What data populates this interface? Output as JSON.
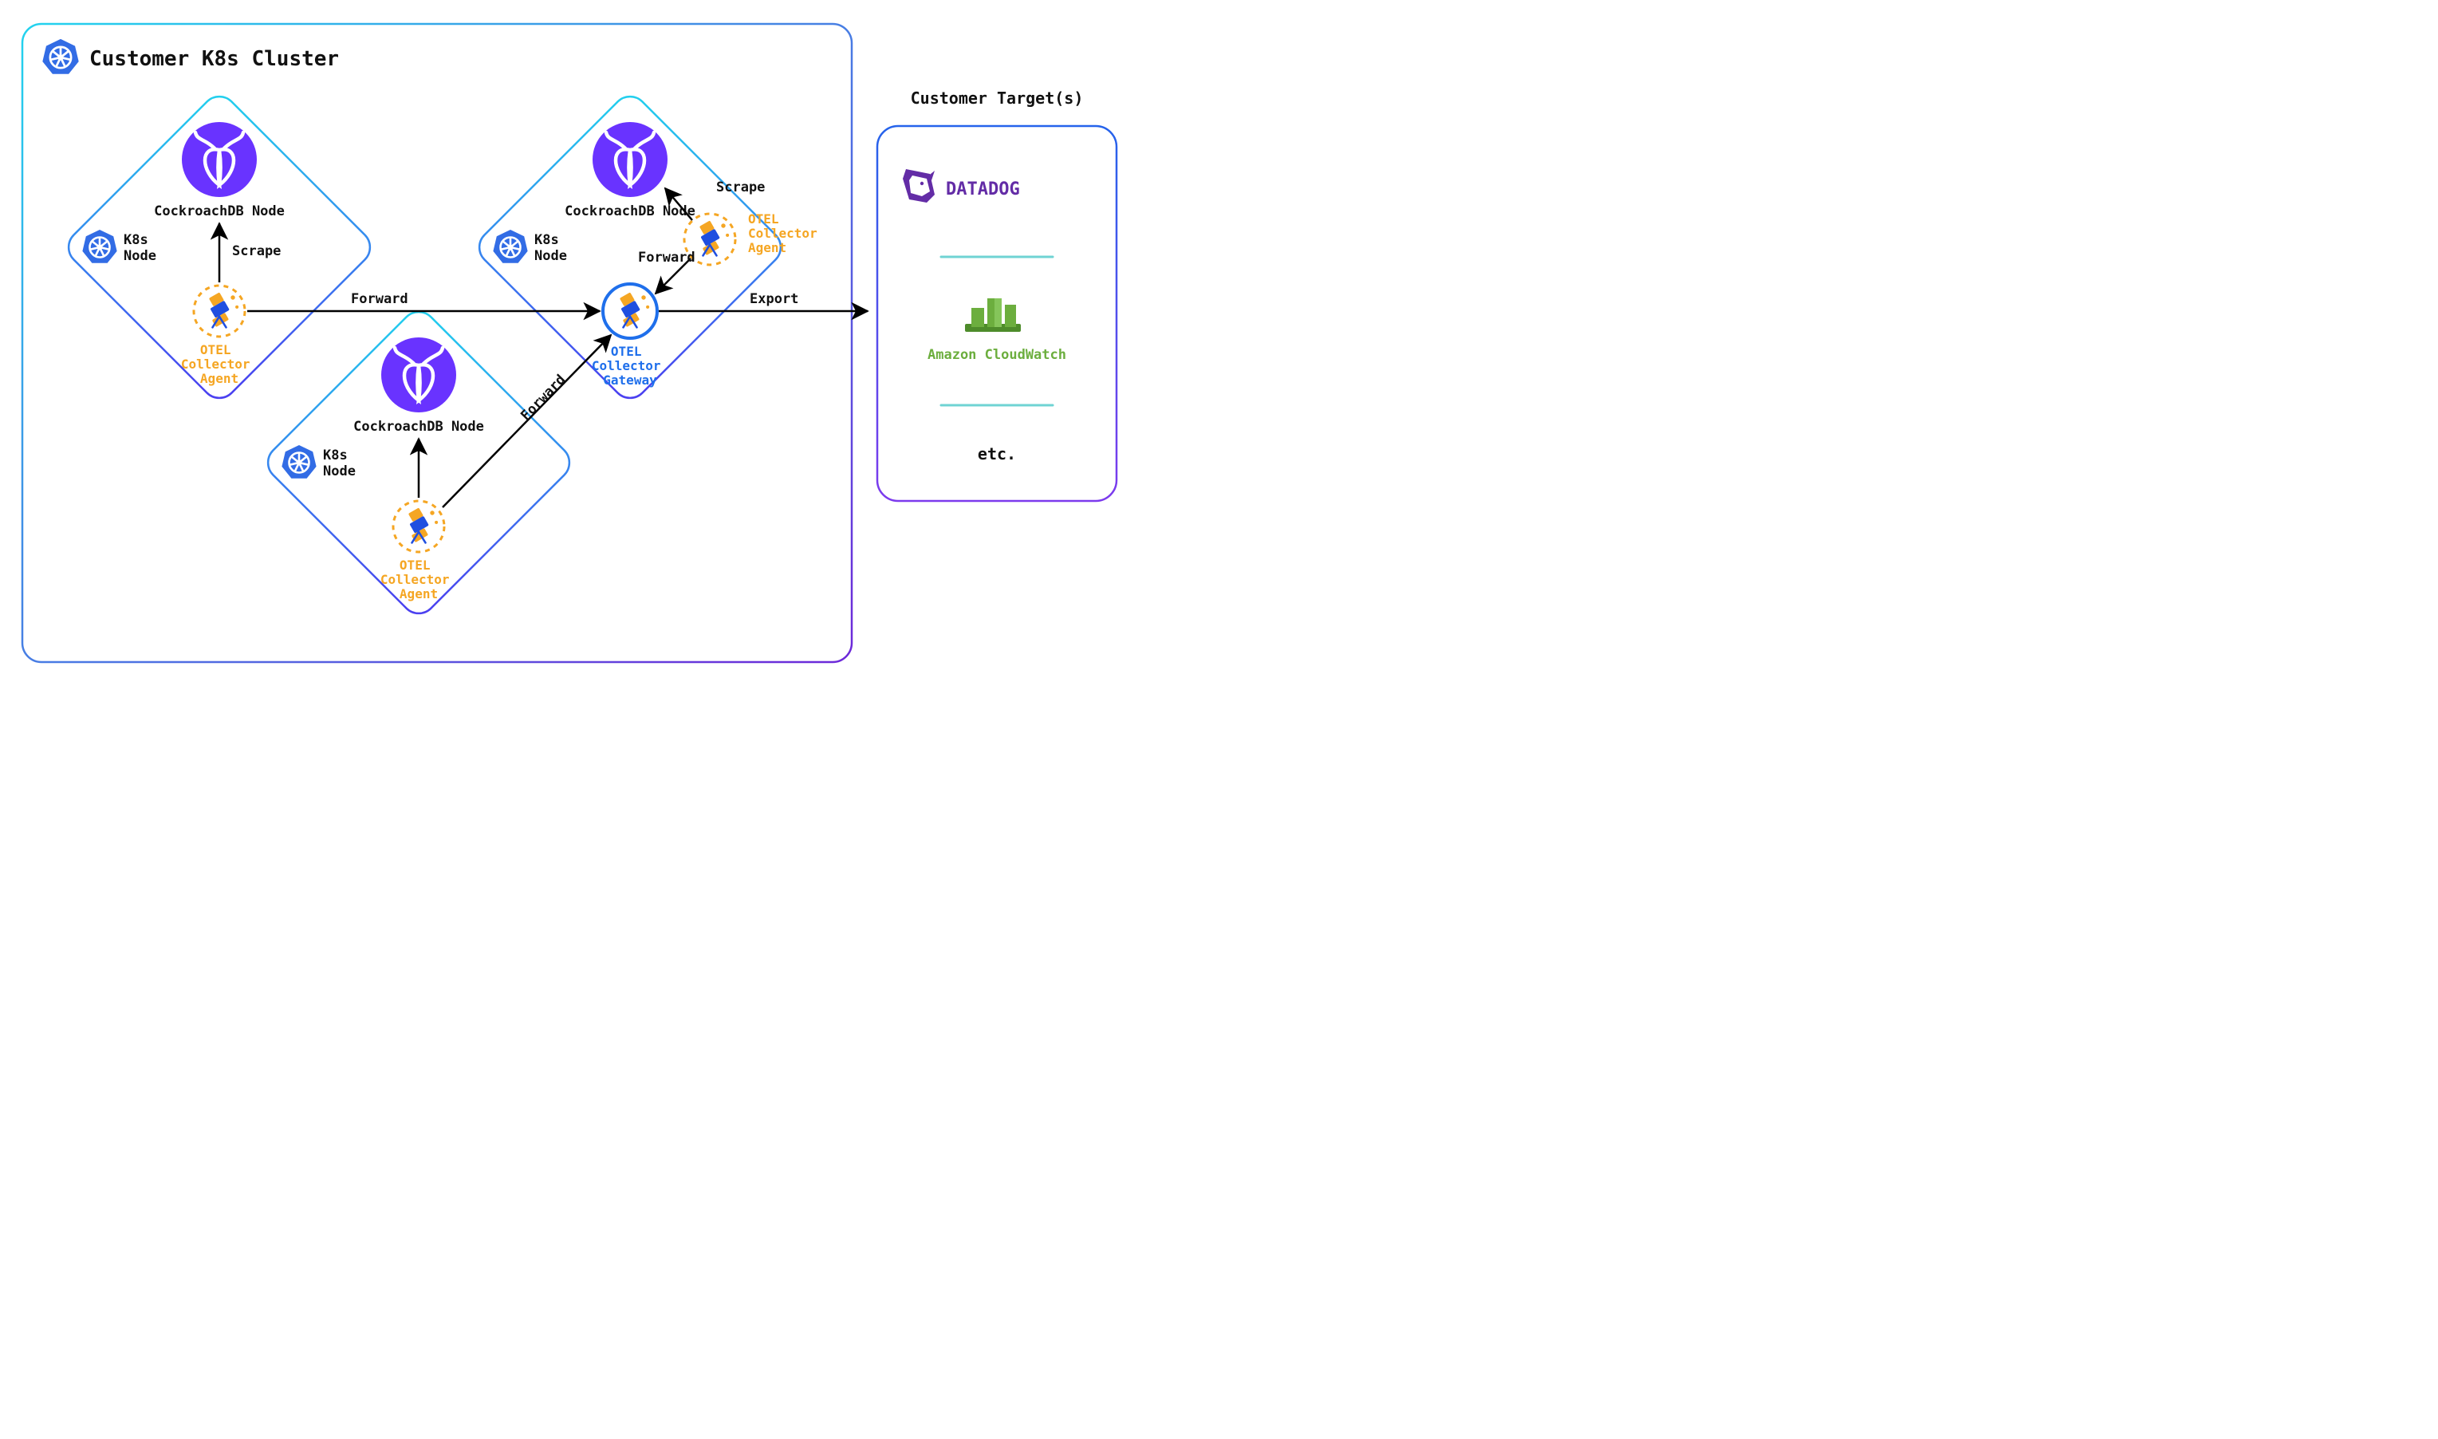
{
  "cluster": {
    "title": "Customer K8s Cluster"
  },
  "nodes": {
    "k8s_label": "K8s\nNode",
    "crdb_label": "CockroachDB Node",
    "otel_agent_label": "OTEL\nCollector\nAgent",
    "otel_gateway_label": "OTEL\nCollector\nGateway"
  },
  "edges": {
    "scrape": "Scrape",
    "forward": "Forward",
    "export": "Export"
  },
  "targets": {
    "title": "Customer Target(s)",
    "datadog": "DATADOG",
    "cloudwatch": "Amazon CloudWatch",
    "etc": "etc."
  },
  "colors": {
    "k8s_blue": "#326CE5",
    "crdb_purple": "#6933FF",
    "otel_orange": "#F5A623",
    "otel_blue": "#1F6FEB",
    "datadog_purple": "#632CA6",
    "aws_green": "#6CAE3E",
    "text": "#111111",
    "divider": "#6FD3D3"
  }
}
